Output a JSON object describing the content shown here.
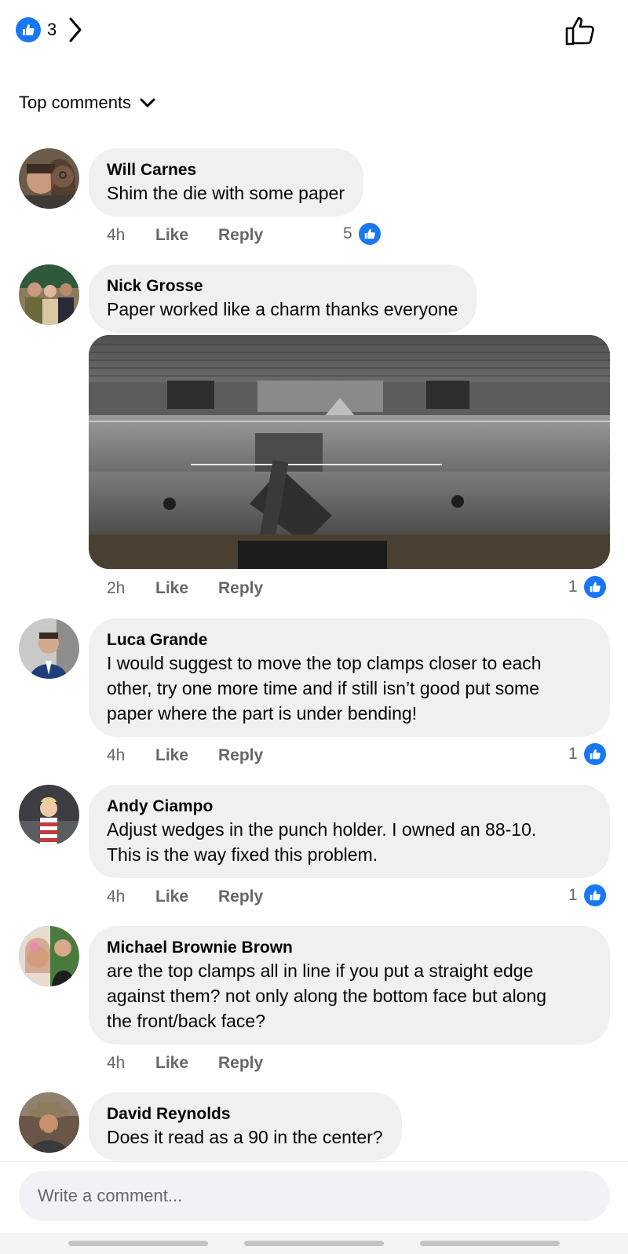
{
  "header": {
    "reaction_count": "3",
    "icons": {
      "reaction": "like-reaction-icon",
      "open": "chevron-right-icon",
      "like_post": "thumbs-up-outline-icon"
    }
  },
  "sort": {
    "label": "Top comments",
    "icon": "chevron-down-icon"
  },
  "comments": [
    {
      "author": "Will Carnes",
      "text": "Shim the die with some paper",
      "time": "4h",
      "like_label": "Like",
      "reply_label": "Reply",
      "reactions": "5"
    },
    {
      "author": "Nick Grosse",
      "text": "Paper worked like a charm thanks everyone",
      "time": "2h",
      "like_label": "Like",
      "reply_label": "Reply",
      "reactions": "1",
      "has_photo": true
    },
    {
      "author": "Luca Grande",
      "text_lines": [
        "I would suggest to move the top clamps closer to each",
        "other, try one more time and if still isn’t good put some",
        "paper where the part is under bending!"
      ],
      "time": "4h",
      "like_label": "Like",
      "reply_label": "Reply",
      "reactions": "1"
    },
    {
      "author": "Andy Ciampo",
      "text_lines": [
        "Adjust wedges in the punch holder. I owned an 88-10.",
        "This is the way fixed this problem."
      ],
      "time": "4h",
      "like_label": "Like",
      "reply_label": "Reply",
      "reactions": "1"
    },
    {
      "author": "Michael Brownie Brown",
      "text_lines": [
        "are the top clamps all in line if you put a straight edge",
        "against them? not only along the bottom face but along",
        "the front/back face?"
      ],
      "time": "4h",
      "like_label": "Like",
      "reply_label": "Reply"
    },
    {
      "author": "David Reynolds",
      "text": "Does it read as a 90 in the center?"
    }
  ],
  "composer": {
    "placeholder": "Write a comment..."
  },
  "colors": {
    "accent": "#1877f2",
    "bubble": "#eff0f2",
    "meta_text": "#65676b"
  }
}
